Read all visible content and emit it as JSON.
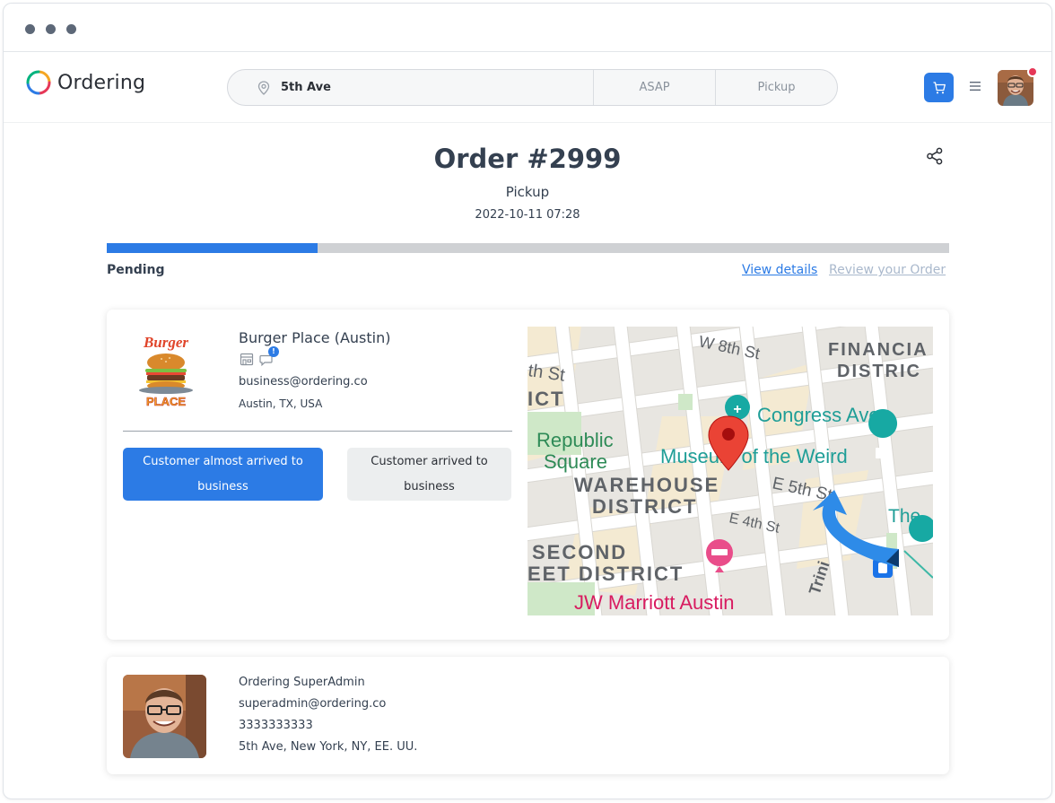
{
  "window": {
    "controls": [
      "close",
      "minimize",
      "maximize"
    ]
  },
  "header": {
    "brand": "Ordering",
    "search": {
      "address": "5th Ave",
      "time": "ASAP",
      "mode": "Pickup"
    },
    "icons": {
      "location": "map-pin-icon",
      "cart": "cart-icon",
      "menu": "hamburger-icon",
      "share": "share-icon"
    },
    "accent_color": "#2c7be5",
    "notification_color": "#e63757"
  },
  "order": {
    "title": "Order #2999",
    "type": "Pickup",
    "date": "2022-10-11 07:28",
    "progress_fraction": 0.25,
    "status": "Pending",
    "view_details": "View details",
    "review": "Review your Order"
  },
  "business": {
    "name": "Burger Place (Austin)",
    "email": "business@ordering.co",
    "address": "Austin, TX, USA",
    "logo": {
      "word1": "Burger",
      "word2": "PLACE"
    },
    "chat_badge": "!",
    "actions": {
      "almost_arrived": "Customer almost arrived to business",
      "arrived": "Customer arrived to business"
    }
  },
  "map": {
    "labels": {
      "w8th": "W 8th St",
      "th_st": "th St",
      "financial1": "FINANCIA",
      "financial2": "DISTRIC",
      "ict": "ICT",
      "congress": "Congress Ave",
      "republic1": "Republic",
      "republic2": "Square",
      "museum": "Museum of the Weird",
      "warehouse1": "WAREHOUSE",
      "warehouse2": "DISTRICT",
      "e5th": "E 5th St",
      "e4th": "E 4th St",
      "the": "The",
      "second1": "SECOND",
      "second2": "EET DISTRICT",
      "marriott": "JW Marriott Austin",
      "trinity": "Trini"
    }
  },
  "customer": {
    "name": "Ordering SuperAdmin",
    "email": "superadmin@ordering.co",
    "phone": "3333333333",
    "address": "5th Ave, New York, NY, EE. UU."
  }
}
